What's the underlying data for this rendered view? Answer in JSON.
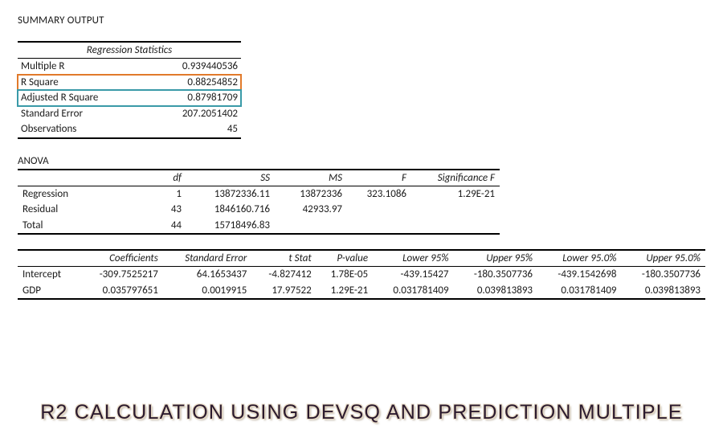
{
  "summary_title": "SUMMARY OUTPUT",
  "stats_header": "Regression Statistics",
  "stats": {
    "multiple_r": {
      "label": "Multiple R",
      "value": "0.939440536"
    },
    "r_square": {
      "label": "R Square",
      "value": "0.88254852"
    },
    "adj_r_square": {
      "label": "Adjusted R Square",
      "value": "0.87981709"
    },
    "std_error": {
      "label": "Standard Error",
      "value": "207.2051402"
    },
    "observations": {
      "label": "Observations",
      "value": "45"
    }
  },
  "anova": {
    "label": "ANOVA",
    "headers": {
      "blank": "",
      "df": "df",
      "ss": "SS",
      "ms": "MS",
      "f": "F",
      "sigf": "Significance F"
    },
    "rows": {
      "regression": {
        "name": "Regression",
        "df": "1",
        "ss": "13872336.11",
        "ms": "13872336",
        "f": "323.1086",
        "sigf": "1.29E-21"
      },
      "residual": {
        "name": "Residual",
        "df": "43",
        "ss": "1846160.716",
        "ms": "42933.97",
        "f": "",
        "sigf": ""
      },
      "total": {
        "name": "Total",
        "df": "44",
        "ss": "15718496.83",
        "ms": "",
        "f": "",
        "sigf": ""
      }
    }
  },
  "coef": {
    "headers": {
      "blank": "",
      "coef": "Coefficients",
      "se": "Standard Error",
      "t": "t Stat",
      "p": "P-value",
      "l95": "Lower 95%",
      "u95": "Upper 95%",
      "l950": "Lower 95.0%",
      "u950": "Upper 95.0%"
    },
    "rows": {
      "intercept": {
        "name": "Intercept",
        "coef": "-309.7525217",
        "se": "64.1653437",
        "t": "-4.827412",
        "p": "1.78E-05",
        "l95": "-439.15427",
        "u95": "-180.3507736",
        "l950": "-439.1542698",
        "u950": "-180.3507736"
      },
      "gdp": {
        "name": "GDP",
        "coef": "0.035797651",
        "se": "0.0019915",
        "t": "17.97522",
        "p": "1.29E-21",
        "l95": "0.031781409",
        "u95": "0.039813893",
        "l950": "0.031781409",
        "u950": "0.039813893"
      }
    }
  },
  "banner": "R2 CALCULATION USING DEVSQ AND PREDICTION MULTIPLE",
  "chart_data": {
    "type": "table",
    "title": "Excel Regression Summary Output",
    "regression_statistics": {
      "Multiple R": 0.939440536,
      "R Square": 0.88254852,
      "Adjusted R Square": 0.87981709,
      "Standard Error": 207.2051402,
      "Observations": 45
    },
    "anova": [
      {
        "Source": "Regression",
        "df": 1,
        "SS": 13872336.11,
        "MS": 13872336,
        "F": 323.1086,
        "Significance F": 1.29e-21
      },
      {
        "Source": "Residual",
        "df": 43,
        "SS": 1846160.716,
        "MS": 42933.97
      },
      {
        "Source": "Total",
        "df": 44,
        "SS": 15718496.83
      }
    ],
    "coefficients": [
      {
        "Term": "Intercept",
        "Coefficients": -309.7525217,
        "Standard Error": 64.1653437,
        "t Stat": -4.827412,
        "P-value": 1.78e-05,
        "Lower 95%": -439.15427,
        "Upper 95%": -180.3507736,
        "Lower 95.0%": -439.1542698,
        "Upper 95.0%": -180.3507736
      },
      {
        "Term": "GDP",
        "Coefficients": 0.035797651,
        "Standard Error": 0.0019915,
        "t Stat": 17.97522,
        "P-value": 1.29e-21,
        "Lower 95%": 0.031781409,
        "Upper 95%": 0.039813893,
        "Lower 95.0%": 0.031781409,
        "Upper 95.0%": 0.039813893
      }
    ]
  }
}
